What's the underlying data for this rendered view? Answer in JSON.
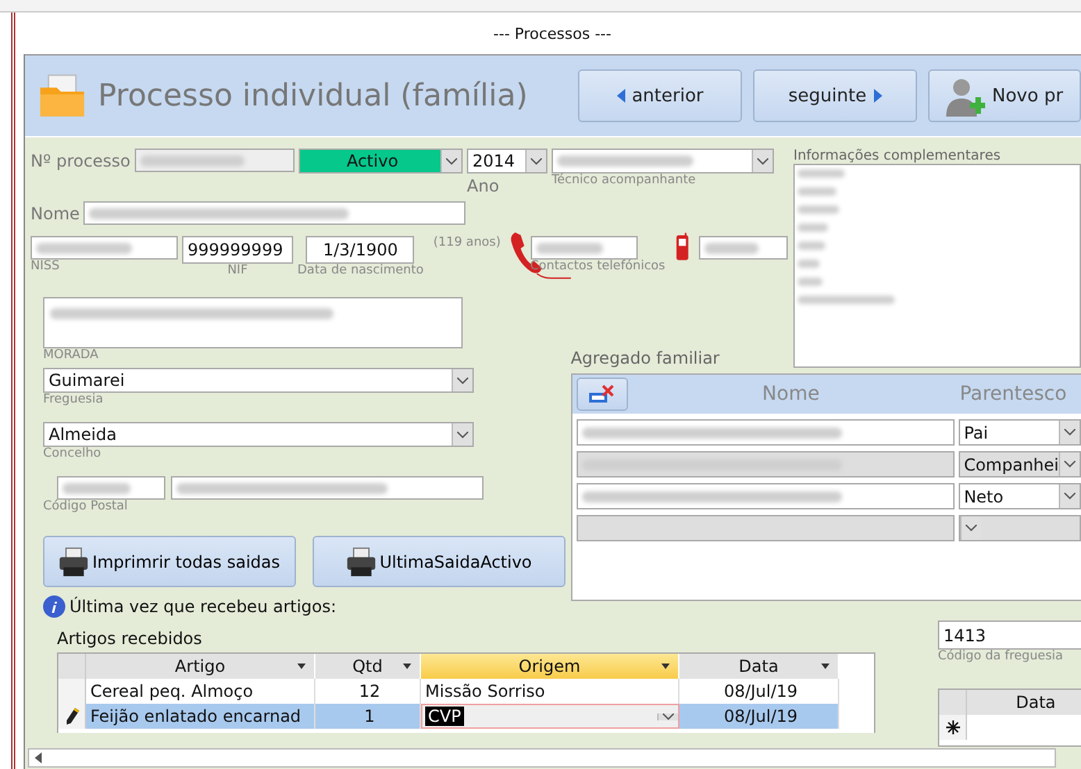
{
  "window": {
    "title": "--- Processos ---"
  },
  "header": {
    "title": "Processo individual (família)",
    "buttons": [
      {
        "label": "anterior",
        "kind": "prev"
      },
      {
        "label": "seguinte",
        "kind": "next"
      },
      {
        "label": "Novo pr",
        "kind": "new"
      }
    ]
  },
  "form": {
    "processo_label": "Nº processo",
    "estado": "Activo",
    "ano": "2014",
    "ano_label": "Ano",
    "tecnico_label": "Técnico acompanhante",
    "nome_label": "Nome",
    "niss_label": "NISS",
    "nif": "999999999",
    "nif_label": "NIF",
    "nascimento": "1/3/1900",
    "nascimento_label": "Data de nascimento",
    "idade": "(119 anos)",
    "contactos_label": "Contactos telefónicos",
    "morada_label": "MORADA",
    "freguesia": "Guimarei",
    "freguesia_label": "Freguesia",
    "concelho": "Almeida",
    "concelho_label": "Concelho",
    "postal_label": "Código Postal"
  },
  "info": {
    "label": "Informações complementares"
  },
  "print_buttons": [
    "Imprimrir todas saidas",
    "UltimaSaidaActivo"
  ],
  "last_received": "Última vez que recebeu artigos:",
  "agregado": {
    "title": "Agregado familiar",
    "columns": [
      "Nome",
      "Parentesco"
    ],
    "rows": [
      {
        "parentesco": "Pai",
        "shaded": false
      },
      {
        "parentesco": "Companhei",
        "shaded": true
      },
      {
        "parentesco": "Neto",
        "shaded": false
      },
      {
        "shaded": true
      }
    ]
  },
  "artigos": {
    "title": "Artigos recebidos",
    "columns": [
      {
        "label": "Artigo",
        "selected": false
      },
      {
        "label": "Qtd",
        "selected": false
      },
      {
        "label": "Origem",
        "selected": true
      },
      {
        "label": "Data",
        "selected": false
      }
    ],
    "rows": [
      {
        "artigo": "Cereal peq. Almoço",
        "qtd": "12",
        "origem": "Missão Sorriso",
        "data": "08/Jul/19",
        "selected": false
      },
      {
        "artigo": "Feijão enlatado encarnad",
        "qtd": "1",
        "origem": "CVP",
        "data": "08/Jul/19",
        "selected": true
      }
    ]
  },
  "freguesia_code": {
    "value": "1413",
    "label": "Código da freguesia"
  },
  "data_grid": {
    "column": "Data"
  }
}
